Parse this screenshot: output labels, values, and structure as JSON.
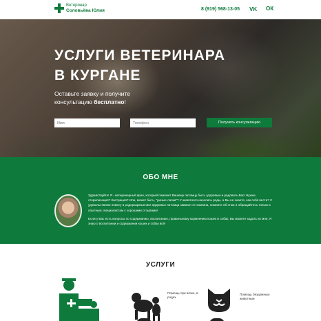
{
  "header": {
    "logo": {
      "line1": "Ветеринар",
      "line2": "Соловьёва Юлия"
    },
    "phone": "8 (919) 568-13-05",
    "social": {
      "vk": "VK",
      "ok": "ОК"
    }
  },
  "hero": {
    "title_line1": "УСЛУГИ ВЕТЕРИНАРА",
    "title_line2": "В КУРГАНЕ",
    "subtitle_part1": "Оставьте заявку и получите консультацию ",
    "subtitle_bold": "бесплатно",
    "subtitle_end": "!",
    "form": {
      "name_placeholder": "Имя",
      "phone_placeholder": "Телефон",
      "submit_label": "Получить консультацию"
    }
  },
  "about": {
    "title": "ОБО МНЕ",
    "paragraph1": "Здравствуйте! Я - ветеринарный врач, который поможет Вашему питомцу быть здоровым и радовать Вас! Нужна стерилизация? Кастрация? Или, может быть, \"умные лапки\"? У животного начались роды, а Вы не знаете, как себя вести? С удовольствием помогу в родоразрешении! Здоровье питомца зависит от хозяина, помните об этом и обращайтесь только к опытным специалистам с хорошими отзывами!",
    "paragraph2": "Если у Вас есть вопросы по содержанию, воспитанию, правильному кормлению кошек и собак, Вы можете задать их мне. Я знаю о воспитании и содержании кошек и собак всё!"
  },
  "services": {
    "title": "УСЛУГИ",
    "items": [
      {
        "label": "Помощь при вязке, в родах"
      },
      {
        "label": "Помощь бездомным животным"
      }
    ]
  },
  "colors": {
    "brand": "#0e7a3b"
  }
}
